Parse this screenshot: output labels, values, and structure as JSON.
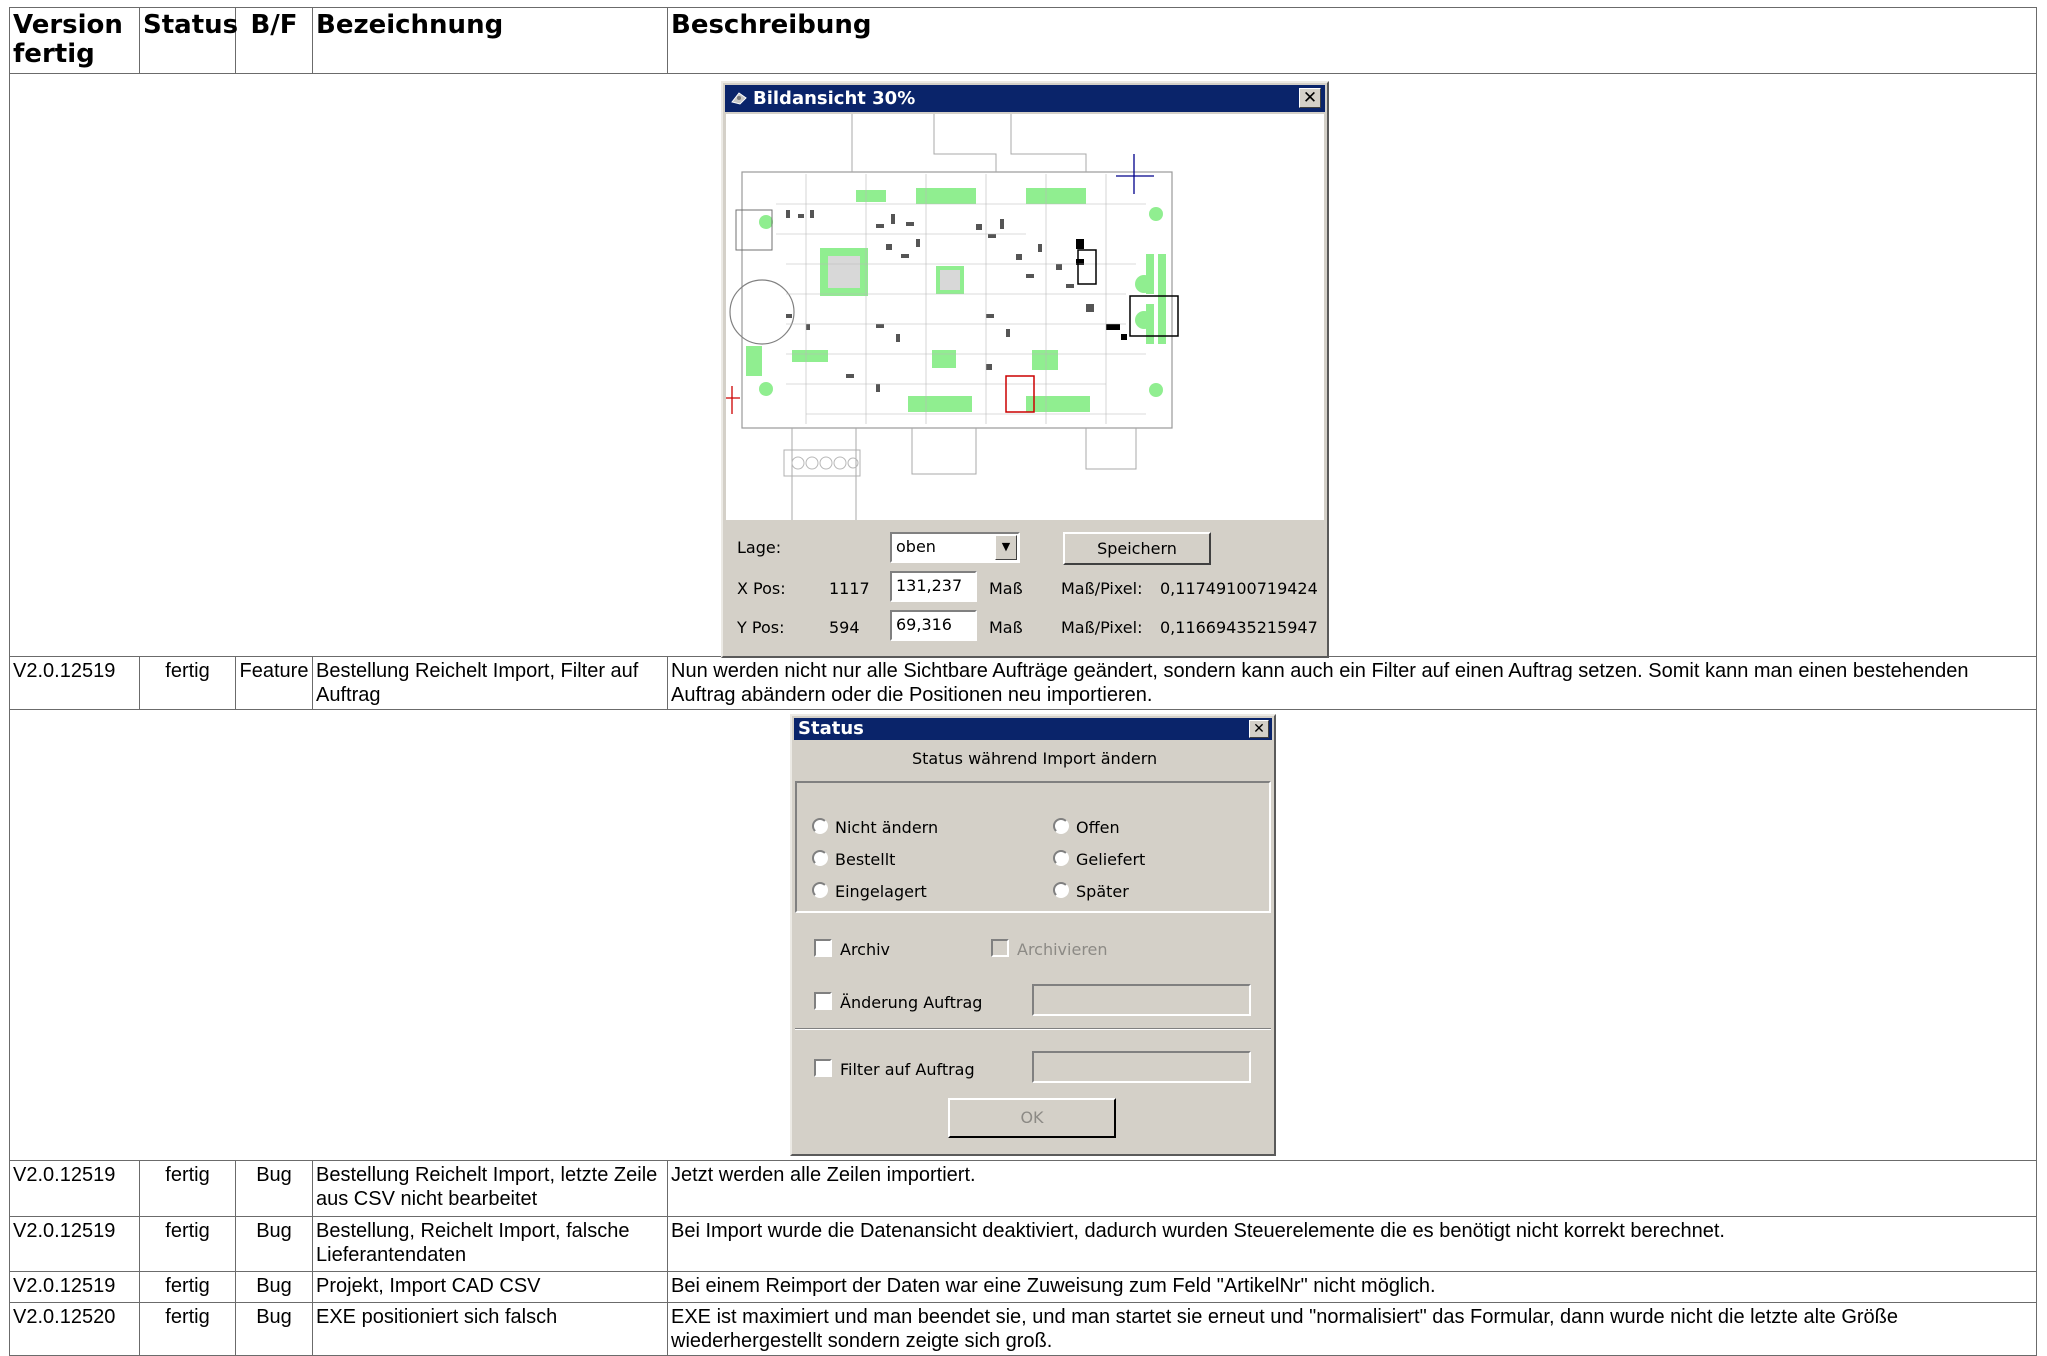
{
  "header": {
    "version": "Version fertig",
    "status": "Status",
    "bf": "B/F",
    "bezeichnung": "Bezeichnung",
    "beschreibung": "Beschreibung"
  },
  "bildansicht": {
    "title": "Bildansicht  30%",
    "close": "✕",
    "lage_label": "Lage:",
    "lage_value": "oben",
    "save_button": "Speichern",
    "x_label": "X Pos:",
    "x_pixel": "1117",
    "x_value": "131,237",
    "x_unit": "Maß",
    "x_scale_label": "Maß/Pixel:",
    "x_scale": "0,11749100719424",
    "y_label": "Y Pos:",
    "y_pixel": "594",
    "y_value": "69,316",
    "y_unit": "Maß",
    "y_scale_label": "Maß/Pixel:",
    "y_scale": "0,11669435215947"
  },
  "rows": [
    {
      "version": "V2.0.12519",
      "status": "fertig",
      "bf": "Feature",
      "bezeichnung": "Bestellung Reichelt Import, Filter auf Auftrag",
      "beschreibung": "Nun werden nicht nur alle Sichtbare Aufträge geändert, sondern kann auch ein Filter auf einen Auftrag setzen. Somit kann man einen bestehenden Auftrag abändern oder die Positionen neu importieren."
    },
    {
      "version": "V2.0.12519",
      "status": "fertig",
      "bf": "Bug",
      "bezeichnung": "Bestellung Reichelt Import, letzte Zeile aus CSV nicht bearbeitet",
      "beschreibung": "Jetzt werden alle Zeilen importiert."
    },
    {
      "version": "V2.0.12519",
      "status": "fertig",
      "bf": "Bug",
      "bezeichnung": "Bestellung, Reichelt Import, falsche Lieferantendaten",
      "beschreibung": "Bei Import wurde die Datenansicht deaktiviert, dadurch wurden Steuerelemente die es benötigt nicht korrekt berechnet."
    },
    {
      "version": "V2.0.12519",
      "status": "fertig",
      "bf": "Bug",
      "bezeichnung": "Projekt, Import CAD CSV",
      "beschreibung": "Bei einem Reimport der Daten war eine Zuweisung zum Feld \"ArtikelNr\" nicht möglich."
    },
    {
      "version": "V2.0.12520",
      "status": "fertig",
      "bf": "Bug",
      "bezeichnung": "EXE positioniert sich falsch",
      "beschreibung": "EXE ist maximiert und man beendet sie, und man startet sie erneut und \"normalisiert\" das Formular, dann wurde nicht die letzte alte Größe wiederhergestellt sondern zeigte sich groß."
    }
  ],
  "status_dialog": {
    "title": "Status",
    "close": "✕",
    "subtitle": "Status während Import ändern",
    "options": [
      "Nicht ändern",
      "Offen",
      "Bestellt",
      "Geliefert",
      "Eingelagert",
      "Später"
    ],
    "archiv": "Archiv",
    "archivieren": "Archivieren",
    "aenderung_auftrag": "Änderung Auftrag",
    "filter_auftrag": "Filter auf Auftrag",
    "ok": "OK"
  }
}
